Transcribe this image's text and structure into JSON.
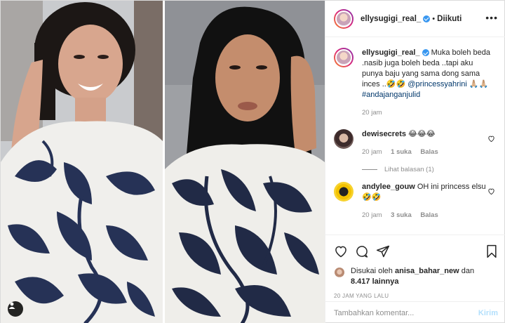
{
  "post": {
    "author": "ellysugigi_real_",
    "follow_separator": "•",
    "follow_state": "Diikuti",
    "more_icon": "more-horizontal-icon",
    "media": {
      "left_photo": "woman-laughing-in-patterned-sweater",
      "right_photo": "woman-in-hijab-in-patterned-sweater",
      "tag_icon": "user-tag-icon"
    }
  },
  "caption": {
    "username": "ellysugigi_real_",
    "verified": true,
    "text_1": " Muka boleh beda .nasib juga boleh beda ..tapi aku punya baju yang sama dong sama inces ..🤣🤣 ",
    "mention": "@princessyahrini",
    "text_2": " 🙏🏼🙏🏼",
    "hashtag": "#andajanganjulid",
    "time": "20 jam"
  },
  "comments": [
    {
      "username": "dewisecrets",
      "text": " 😂😂😂",
      "time": "20 jam",
      "likes": "1 suka",
      "reply": "Balas",
      "view_replies": "Lihat balasan (1)"
    },
    {
      "username": "andylee_gouw",
      "text": " OH ini princess elsu 🤣🤣",
      "time": "20 jam",
      "likes": "3 suka",
      "reply": "Balas"
    }
  ],
  "actions": {
    "like_icon": "heart-icon",
    "comment_icon": "comment-icon",
    "share_icon": "share-icon",
    "save_icon": "bookmark-icon"
  },
  "likes": {
    "prefix": "Disukai oleh ",
    "user": "anisa_bahar_new",
    "middle": " dan ",
    "count": "8.417 lainnya"
  },
  "time_ago": "20 JAM YANG LALU",
  "comment_box": {
    "placeholder": "Tambahkan komentar...",
    "post_label": "Kirim"
  },
  "colors": {
    "link": "#00376b",
    "verified": "#3897f0",
    "muted": "#8e8e8e",
    "post_disabled": "#b2dffc"
  }
}
